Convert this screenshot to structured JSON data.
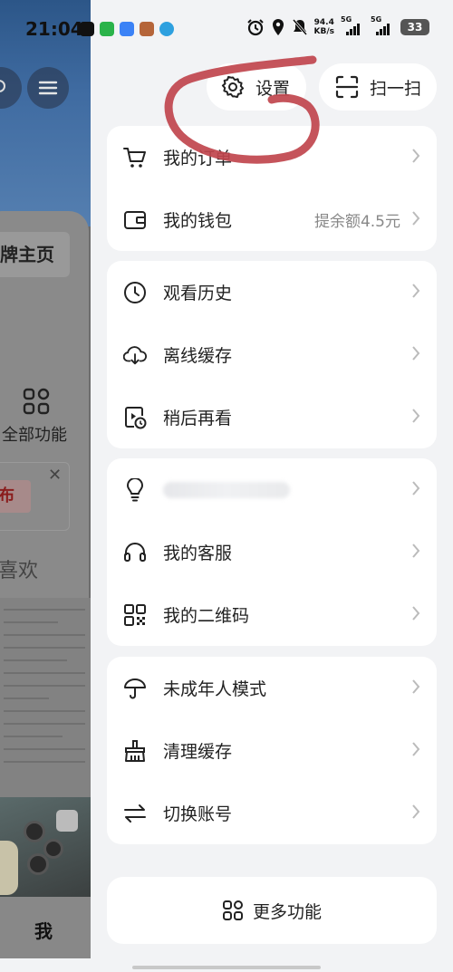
{
  "status_bar": {
    "time": "21:04",
    "net_speed_value": "94.4",
    "net_speed_unit": "KB/s",
    "sim1": "5G",
    "sim2": "5G",
    "battery": "33"
  },
  "background_page": {
    "home_label": "牌主页",
    "all_functions": "全部功能",
    "publish": "布",
    "likes": "喜欢",
    "me_tab": "我"
  },
  "top_actions": {
    "settings_label": "设置",
    "scan_label": "扫一扫"
  },
  "sections": [
    {
      "items": [
        {
          "label": "我的订单",
          "icon": "cart-icon"
        },
        {
          "label": "我的钱包",
          "icon": "wallet-icon",
          "extra": "提余额4.5元"
        }
      ]
    },
    {
      "items": [
        {
          "label": "观看历史",
          "icon": "clock-icon"
        },
        {
          "label": "离线缓存",
          "icon": "cloud-download-icon"
        },
        {
          "label": "稍后再看",
          "icon": "watch-later-icon"
        }
      ]
    },
    {
      "items": [
        {
          "label": "",
          "icon": "lightbulb-icon"
        },
        {
          "label": "我的客服",
          "icon": "headset-icon"
        },
        {
          "label": "我的二维码",
          "icon": "qr-code-icon"
        }
      ]
    },
    {
      "items": [
        {
          "label": "未成年人模式",
          "icon": "umbrella-icon"
        },
        {
          "label": "清理缓存",
          "icon": "broom-icon"
        },
        {
          "label": "切换账号",
          "icon": "switch-arrows-icon"
        }
      ]
    }
  ],
  "more_functions": "更多功能",
  "colors": {
    "annotation": "#c0454d",
    "drawer_bg": "#f2f3f5",
    "card_bg": "#ffffff"
  }
}
